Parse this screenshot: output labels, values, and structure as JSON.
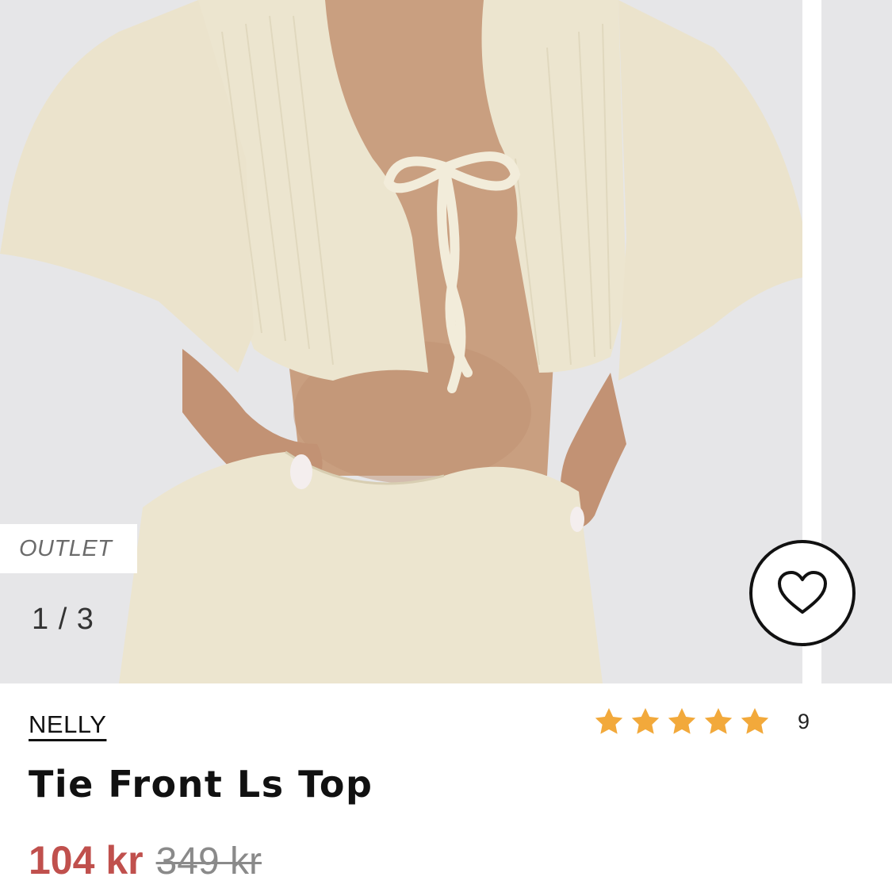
{
  "gallery": {
    "badge": "OUTLET",
    "counter": "1 / 3",
    "favorite_icon": "heart-icon",
    "photo_description_colors": {
      "backdrop": "#e6e6e8",
      "garment": "#ece5cf",
      "skin": "#c99f80"
    }
  },
  "product": {
    "brand": "NELLY",
    "title": "Tie Front Ls Top",
    "price_sale": "104 kr",
    "price_original": "349 kr",
    "rating": {
      "stars": 5,
      "max": 5,
      "review_count": "9",
      "star_color": "#f2a93b",
      "icon": "star-icon"
    },
    "sale_color": "#c0504d"
  }
}
